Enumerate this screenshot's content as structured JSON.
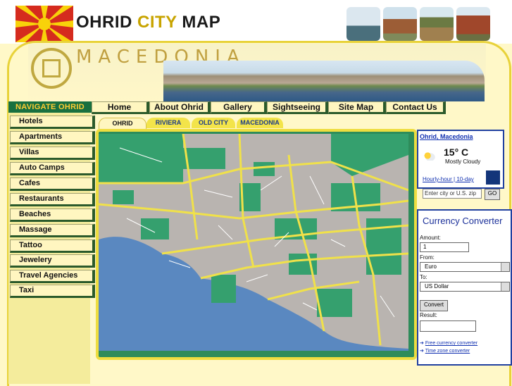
{
  "header": {
    "title_part1": "OHRID ",
    "title_part2": "CITY",
    "title_part3": " MAP",
    "brand": "MACEDONIA",
    "accent_color": "#e8d23a",
    "nav_green": "#187040"
  },
  "sidebar": {
    "heading": "NAVIGATE OHRID",
    "items": [
      {
        "label": "Hotels"
      },
      {
        "label": "Apartments"
      },
      {
        "label": "Villas"
      },
      {
        "label": "Auto Camps"
      },
      {
        "label": "Cafes"
      },
      {
        "label": "Restaurants"
      },
      {
        "label": "Beaches"
      },
      {
        "label": "Massage"
      },
      {
        "label": "Tattoo"
      },
      {
        "label": "Jewelery"
      },
      {
        "label": "Travel Agencies"
      },
      {
        "label": "Taxi"
      }
    ]
  },
  "topnav": {
    "items": [
      {
        "label": "Home"
      },
      {
        "label": "About Ohrid"
      },
      {
        "label": "Gallery"
      },
      {
        "label": "Sightseeing"
      },
      {
        "label": "Site Map"
      },
      {
        "label": "Contact Us"
      }
    ]
  },
  "map_tabs": [
    {
      "label": "OHRID",
      "active": true
    },
    {
      "label": "RIVIERA",
      "active": false
    },
    {
      "label": "OLD CITY",
      "active": false
    },
    {
      "label": "MACEDONIA",
      "active": false
    }
  ],
  "weather": {
    "location": "Ohrid, Macedonia",
    "temperature": "15° C",
    "condition": "Mostly Cloudy",
    "link_hourly": "Hourly-hour",
    "link_sep": " | ",
    "link_10day": "10-day",
    "search_placeholder": "Enter city or U.S. zip",
    "go_label": "GO",
    "icon": "partly-cloudy-icon"
  },
  "currency": {
    "title": "Currency Converter",
    "amount_label": "Amount:",
    "amount_value": "1",
    "from_label": "From:",
    "from_value": "Euro",
    "to_label": "To:",
    "to_value": "US Dollar",
    "convert_label": "Convert",
    "result_label": "Result:",
    "link1": "Free currency converter",
    "link2": "Time zone converter"
  }
}
